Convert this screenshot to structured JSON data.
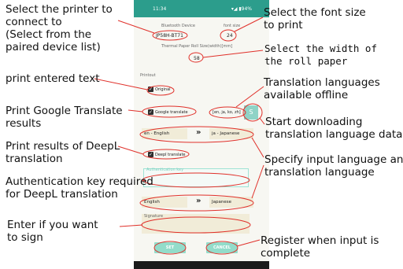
{
  "status": {
    "time": "11:34",
    "right": "▾◢ ▮94%"
  },
  "form": {
    "bluetooth_label": "Bluetooth Device",
    "bluetooth_value": "JP58H-BT71",
    "font_size_label": "font size",
    "font_size_value": "24",
    "paper_width_label": "Thermal Paper Roll Size(width)[mm]",
    "paper_width_value": "58",
    "printout_label": "Printout",
    "original_label": "Original",
    "google_label": "Google translate",
    "offline_langs": "[en, ja, ko, zh]",
    "download_icon": "S",
    "google_src": "en - English",
    "google_dst": "ja - Japanese",
    "deepl_label": "Deepl translate",
    "auth_label": "Authentication key",
    "deepl_src": "English",
    "deepl_dst": "Japanese",
    "arrow": "»",
    "signature_label": "Signature",
    "set_label": "SET",
    "cancel_label": "CANCEL"
  },
  "annotations": {
    "printer": "Select the printer to\nconnect to\n(Select from the\npaired device list)",
    "font": "Select the font size\nto print",
    "width": "Select the width of\nthe roll paper",
    "print_text": "print entered text",
    "offline": "Translation languages\navailable offline",
    "google": "Print Google Translate\nresults",
    "download": "Start downloading\ntranslation language data",
    "deepl": "Print results of DeepL\ntranslation",
    "lang": "Specify input language and\ntranslation language",
    "auth": "Authentication key required\nfor DeepL translation",
    "sign": "Enter if you want\nto sign",
    "register": "Register when input is\ncomplete"
  },
  "colors": {
    "accent": "#2c9d8c",
    "annotation": "#e0302a",
    "button": "#93dcca"
  }
}
